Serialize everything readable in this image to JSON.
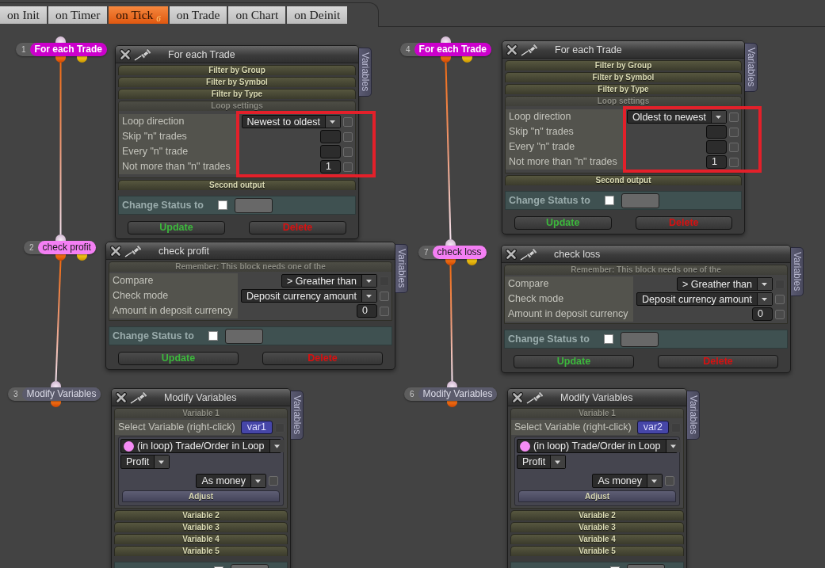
{
  "tabs": [
    {
      "label": "on Init",
      "selected": false
    },
    {
      "label": "on Timer",
      "selected": false
    },
    {
      "label": "on Tick $_{6}$",
      "selected": true
    },
    {
      "label": "on Trade",
      "selected": false
    },
    {
      "label": "on Chart",
      "selected": false
    },
    {
      "label": "on Deinit",
      "selected": false
    }
  ],
  "flows": [
    {
      "blocks": [
        {
          "number": "1",
          "label": "For each Trade",
          "kind": "loop",
          "panel": {
            "title": "For each Trade",
            "side_tab": "Variables",
            "sections": [
              {
                "kind": "bar",
                "label": "Filter by Group"
              },
              {
                "kind": "bar",
                "label": "Filter by Symbol"
              },
              {
                "kind": "bar",
                "label": "Filter by Type"
              },
              {
                "kind": "group",
                "label": "Loop settings",
                "highlighted": true,
                "fields": [
                  {
                    "label": "Loop direction",
                    "kind": "dropdown",
                    "value": "Newest to oldest",
                    "checked": false,
                    "disabled": false
                  },
                  {
                    "label": "Skip \"n\" trades",
                    "kind": "number",
                    "checked": false,
                    "disabled": false
                  },
                  {
                    "label": "Every \"n\" trade",
                    "kind": "number",
                    "checked": false,
                    "disabled": false
                  },
                  {
                    "label": "Not more than \"n\" trades",
                    "kind": "number",
                    "value": "1",
                    "checked": false,
                    "disabled": false
                  }
                ]
              },
              {
                "kind": "bar",
                "label": "Second output"
              }
            ],
            "status_label": "Change Status to",
            "status_checked": false,
            "buttons": [
              {
                "label": "Update",
                "kind": "update"
              },
              {
                "label": "Delete",
                "kind": "delete"
              }
            ]
          }
        },
        {
          "number": "2",
          "label": "check profit",
          "kind": "condition",
          "panel": {
            "title": "check profit",
            "side_tab": "Variables",
            "sections": [
              {
                "kind": "group",
                "label": "Remember: This block needs one of the",
                "fields": [
                  {
                    "label": "Compare",
                    "kind": "dropdown",
                    "value": "> Greather than",
                    "checked": false,
                    "disabled": true
                  },
                  {
                    "label": "Check mode",
                    "kind": "dropdown",
                    "value": "Deposit currency amount",
                    "checked": false,
                    "disabled": false
                  },
                  {
                    "label": "Amount in deposit currency",
                    "kind": "number",
                    "value": "0",
                    "checked": false,
                    "disabled": false
                  }
                ]
              }
            ],
            "status_label": "Change Status to",
            "status_checked": false,
            "buttons": [
              {
                "label": "Update",
                "kind": "update"
              },
              {
                "label": "Delete",
                "kind": "delete"
              }
            ]
          }
        },
        {
          "number": "3",
          "label": "Modify Variables",
          "kind": "action",
          "panel": {
            "title": "Modify Variables",
            "side_tab": "Variables",
            "sections": [
              {
                "kind": "group",
                "label": "Variable 1",
                "fields": [
                  {
                    "label": "Select Variable (right-click)",
                    "kind": "variable",
                    "value": "var1",
                    "checked": false,
                    "disabled": true
                  }
                ],
                "editor": {
                  "source": "(in loop) Trade/Order in Loop",
                  "property": "Profit",
                  "format": "As money",
                  "format_checked": false,
                  "button": "Adjust"
                }
              },
              {
                "kind": "bar",
                "label": "Variable 2"
              },
              {
                "kind": "bar",
                "label": "Variable 3"
              },
              {
                "kind": "bar",
                "label": "Variable 4"
              },
              {
                "kind": "bar",
                "label": "Variable 5"
              }
            ],
            "status_checked": false
          }
        }
      ]
    },
    {
      "blocks": [
        {
          "number": "4",
          "label": "For each Trade",
          "kind": "loop",
          "panel": {
            "title": "For each Trade",
            "side_tab": "Variables",
            "sections": [
              {
                "kind": "bar",
                "label": "Filter by Group"
              },
              {
                "kind": "bar",
                "label": "Filter by Symbol"
              },
              {
                "kind": "bar",
                "label": "Filter by Type"
              },
              {
                "kind": "group",
                "label": "Loop settings",
                "highlighted": true,
                "fields": [
                  {
                    "label": "Loop direction",
                    "kind": "dropdown",
                    "value": "Oldest to newest",
                    "checked": false,
                    "disabled": false
                  },
                  {
                    "label": "Skip \"n\" trades",
                    "kind": "number",
                    "checked": false,
                    "disabled": false
                  },
                  {
                    "label": "Every \"n\" trade",
                    "kind": "number",
                    "checked": false,
                    "disabled": false
                  },
                  {
                    "label": "Not more than \"n\" trades",
                    "kind": "number",
                    "value": "1",
                    "checked": false,
                    "disabled": false
                  }
                ]
              },
              {
                "kind": "bar",
                "label": "Second output"
              }
            ],
            "status_label": "Change Status to",
            "status_checked": false,
            "buttons": [
              {
                "label": "Update",
                "kind": "update"
              },
              {
                "label": "Delete",
                "kind": "delete"
              }
            ]
          }
        },
        {
          "number": "7",
          "label": "check loss",
          "kind": "condition",
          "panel": {
            "title": "check loss",
            "side_tab": "Variables",
            "sections": [
              {
                "kind": "group",
                "label": "Remember: This block needs one of the",
                "fields": [
                  {
                    "label": "Compare",
                    "kind": "dropdown",
                    "value": "> Greather than",
                    "checked": false,
                    "disabled": true
                  },
                  {
                    "label": "Check mode",
                    "kind": "dropdown",
                    "value": "Deposit currency amount",
                    "checked": false,
                    "disabled": false
                  },
                  {
                    "label": "Amount in deposit currency",
                    "kind": "number",
                    "value": "0",
                    "checked": false,
                    "disabled": false
                  }
                ]
              }
            ],
            "status_label": "Change Status to",
            "status_checked": false,
            "buttons": [
              {
                "label": "Update",
                "kind": "update"
              },
              {
                "label": "Delete",
                "kind": "delete"
              }
            ]
          }
        },
        {
          "number": "6",
          "label": "Modify Variables",
          "kind": "action",
          "panel": {
            "title": "Modify Variables",
            "side_tab": "Variables",
            "sections": [
              {
                "kind": "group",
                "label": "Variable 1",
                "fields": [
                  {
                    "label": "Select Variable (right-click)",
                    "kind": "variable",
                    "value": "var2",
                    "checked": false,
                    "disabled": true
                  }
                ],
                "editor": {
                  "source": "(in loop) Trade/Order in Loop",
                  "property": "Profit",
                  "format": "As money",
                  "format_checked": false,
                  "button": "Adjust"
                }
              },
              {
                "kind": "bar",
                "label": "Variable 2"
              },
              {
                "kind": "bar",
                "label": "Variable 3"
              },
              {
                "kind": "bar",
                "label": "Variable 4"
              },
              {
                "kind": "bar",
                "label": "Variable 5"
              }
            ],
            "status_checked": false
          }
        }
      ]
    }
  ]
}
